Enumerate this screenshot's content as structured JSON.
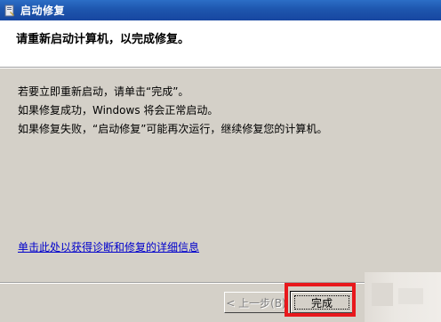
{
  "window": {
    "title": "启动修复",
    "icon": "startup-repair-icon"
  },
  "header": {
    "instruction": "请重新启动计算机，以完成修复。"
  },
  "content": {
    "line1": "若要立即重新启动，请单击“完成”。",
    "line2": "如果修复成功，Windows 将会正常启动。",
    "line3": "如果修复失败，“启动修复”可能再次运行，继续修复您的计算机。",
    "details_link": "单击此处以获得诊断和修复的详细信息"
  },
  "buttons": {
    "back_label": "< 上一步(B)",
    "finish_label": "完成"
  },
  "colors": {
    "titlebar": "#1e56ae",
    "link": "#0000cc",
    "highlight": "#e8181c",
    "face": "#d4d0c8"
  }
}
